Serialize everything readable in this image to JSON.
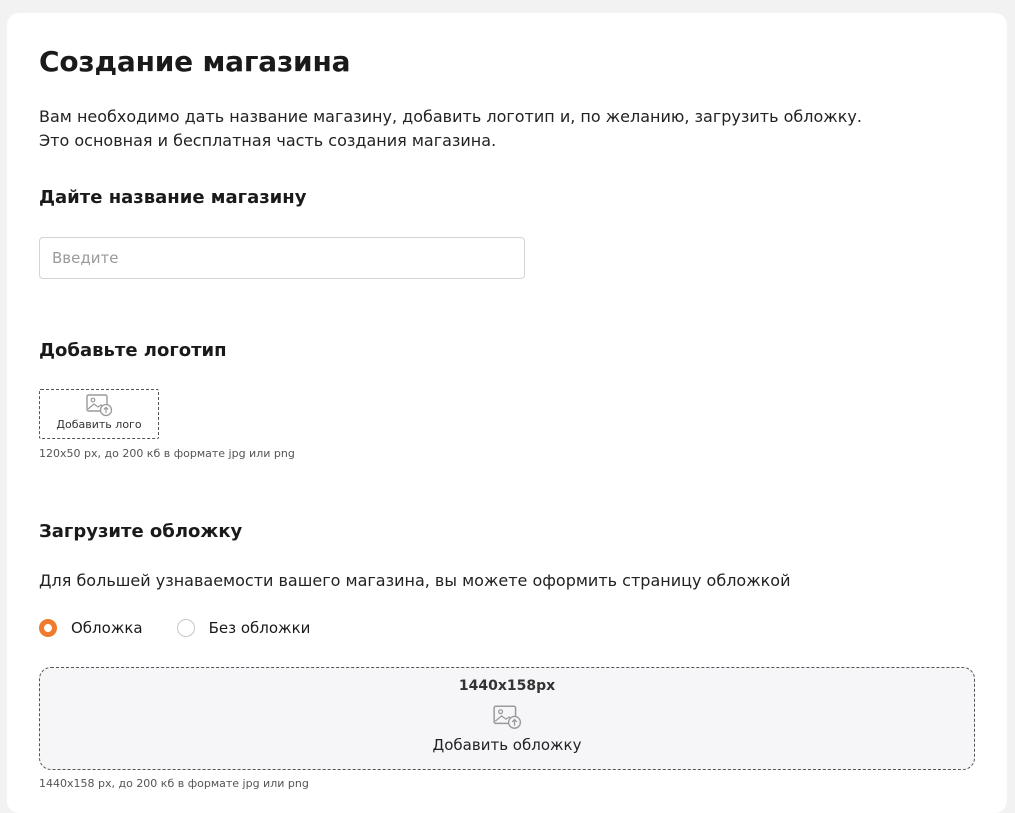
{
  "page": {
    "title": "Создание магазина",
    "description": {
      "line1": "Вам необходимо дать название магазину, добавить логотип и, по желанию, загрузить обложку.",
      "line2": "Это основная и бесплатная часть создания магазина."
    }
  },
  "store_name": {
    "heading": "Дайте название магазину",
    "placeholder": "Введите",
    "value": ""
  },
  "logo": {
    "heading": "Добавьте логотип",
    "button_label": "Добавить лого",
    "icon": "image-upload-icon",
    "hint": "120x50 px, до 200 кб в формате jpg или png"
  },
  "cover": {
    "heading": "Загрузите обложку",
    "description": "Для большей узнаваемости вашего магазина, вы можете оформить страницу обложкой",
    "options": [
      {
        "label": "Обложка",
        "selected": true
      },
      {
        "label": "Без обложки",
        "selected": false
      }
    ],
    "size_label": "1440x158px",
    "button_label": "Добавить обложку",
    "icon": "image-upload-icon",
    "hint": "1440x158 px, до 200 кб в формате jpg или png"
  },
  "colors": {
    "accent": "#f07a2e",
    "background": "#f2f2f2",
    "card": "#ffffff",
    "upload_area": "#f6f6f9"
  }
}
